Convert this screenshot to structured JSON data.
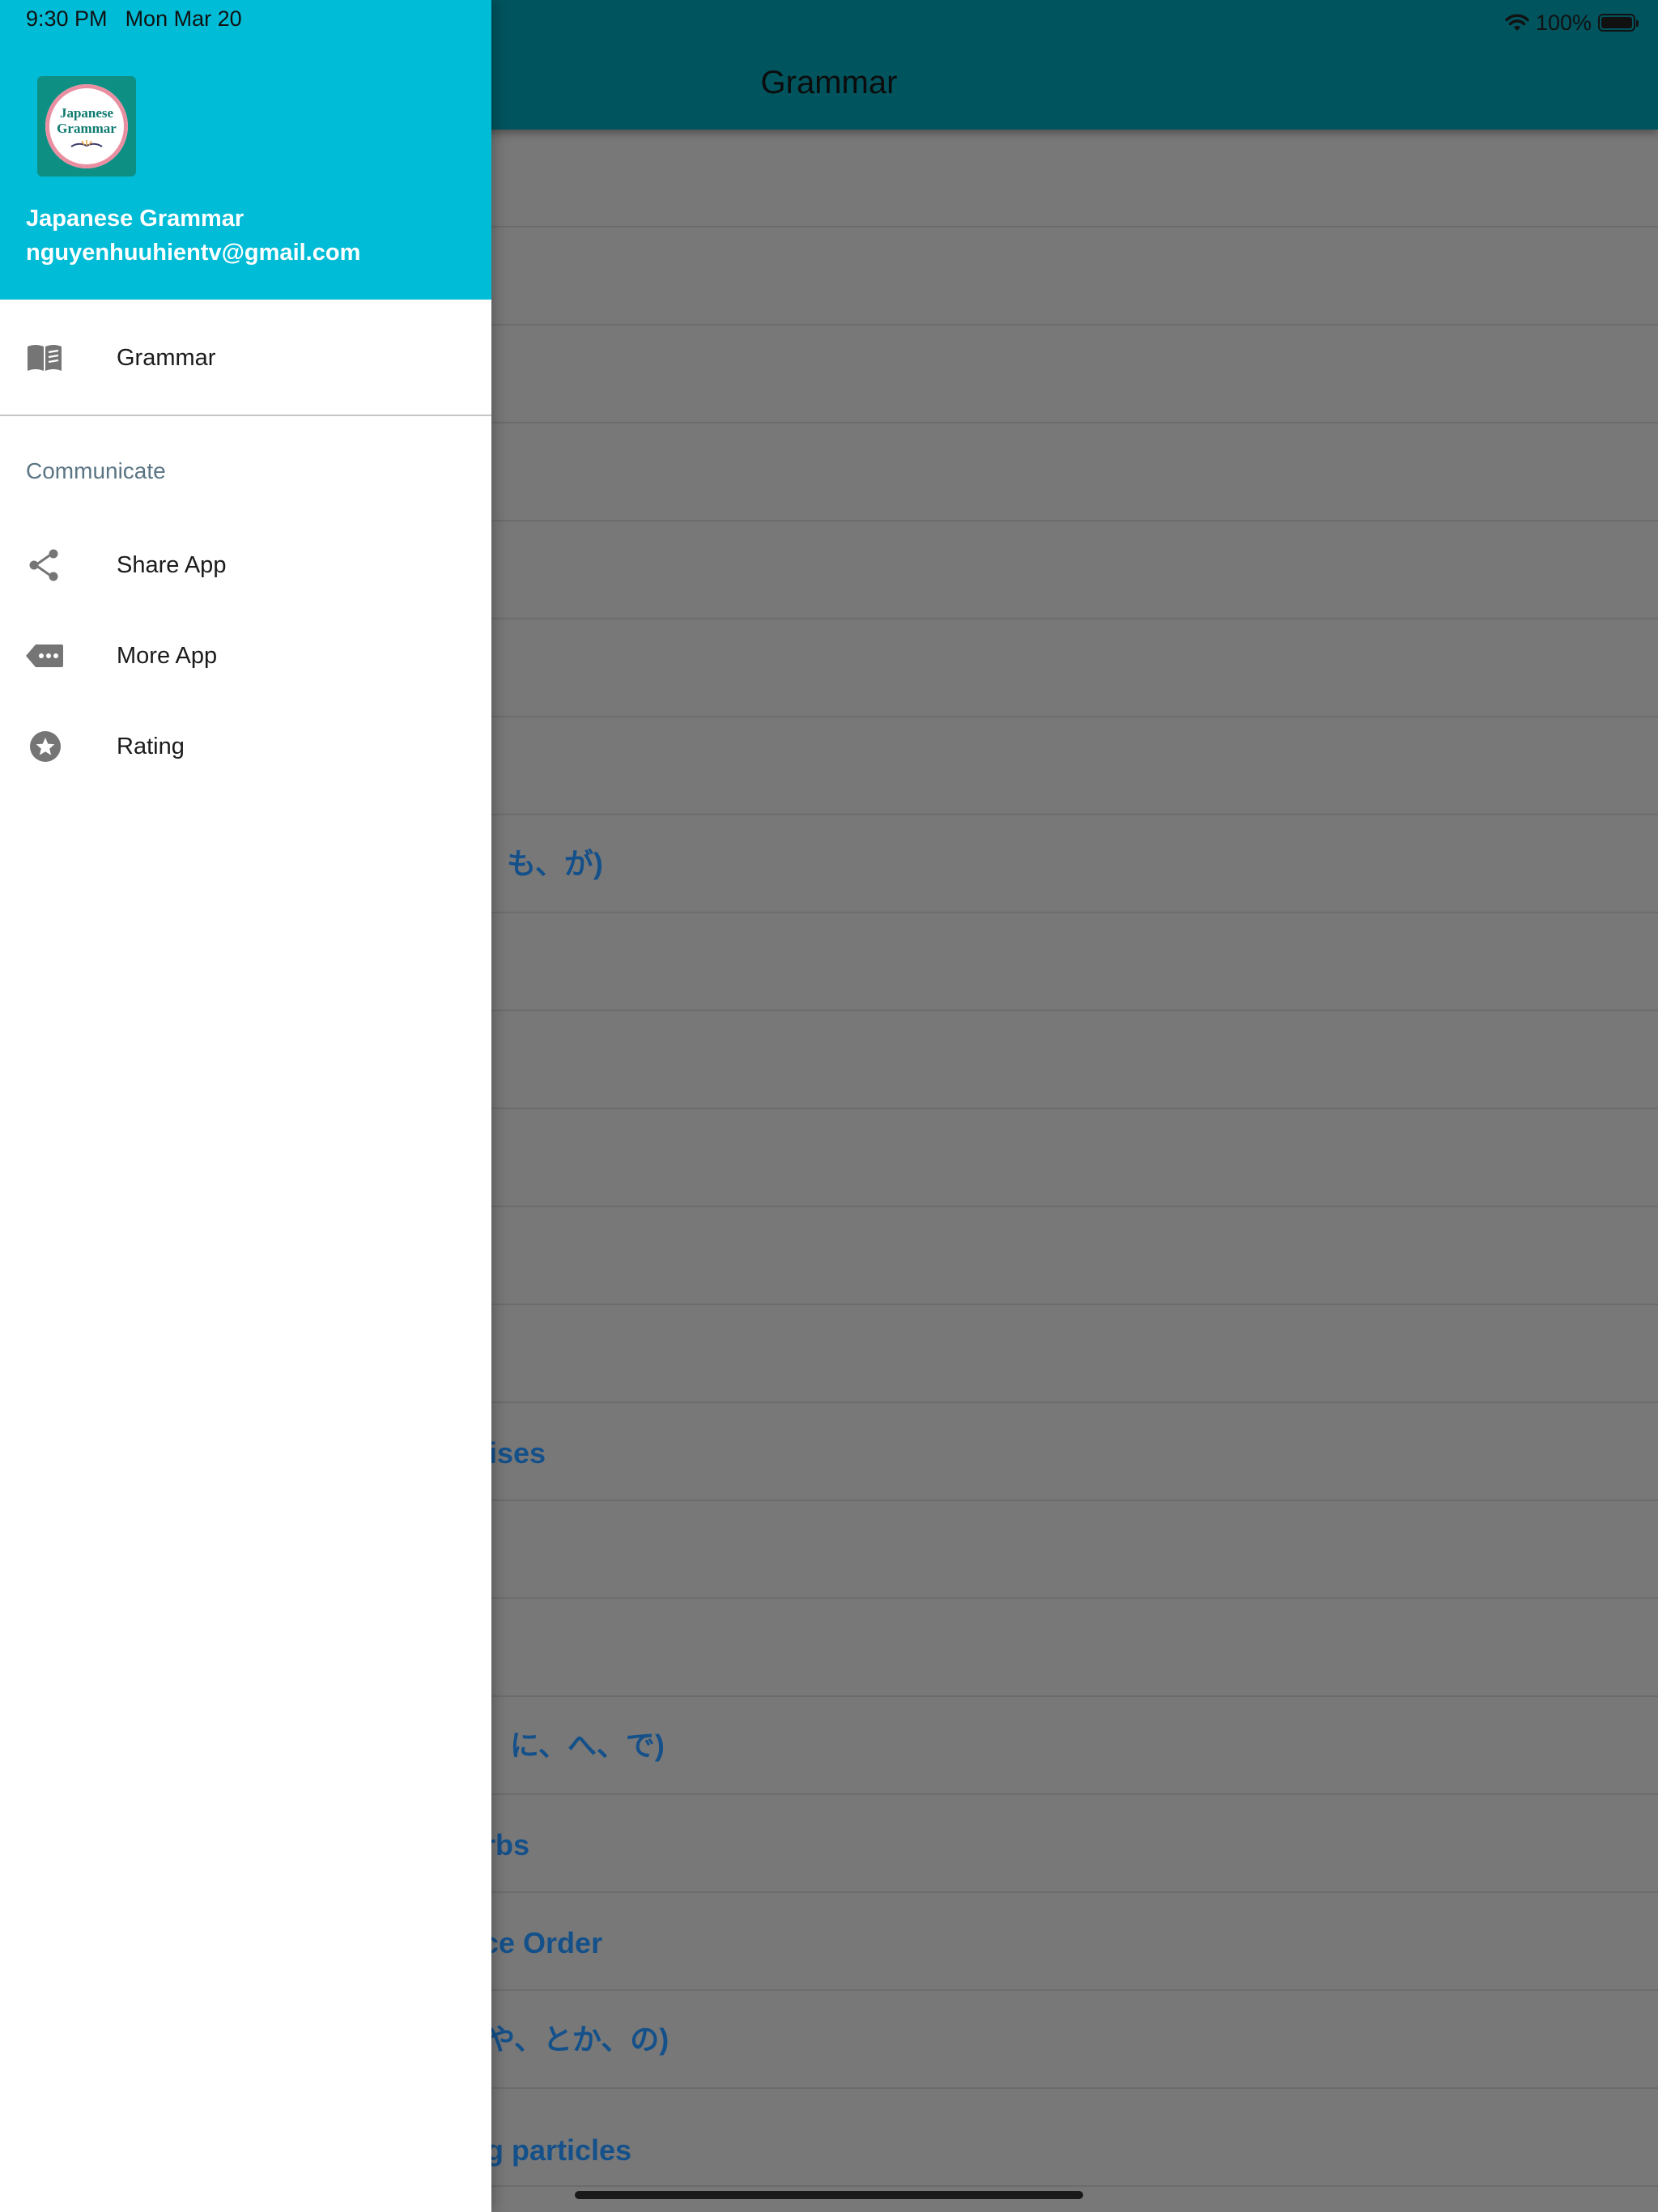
{
  "status_bar": {
    "time": "9:30 PM",
    "date": "Mon Mar 20",
    "battery": "100%"
  },
  "app_bar": {
    "title": "Grammar"
  },
  "background_list": {
    "rows": [
      {
        "text": ""
      },
      {
        "text": ""
      },
      {
        "text": ""
      },
      {
        "text": ""
      },
      {
        "text": ""
      },
      {
        "text": ""
      },
      {
        "text": ""
      },
      {
        "text": "も、が)"
      },
      {
        "text": ""
      },
      {
        "text": ""
      },
      {
        "text": ""
      },
      {
        "text": ""
      },
      {
        "text": ""
      },
      {
        "text": "ises"
      },
      {
        "text": ""
      },
      {
        "text": ""
      },
      {
        "text": "、に、へ、で)"
      },
      {
        "text": "rbs"
      },
      {
        "text": "ce Order"
      },
      {
        "text": "や、とか、の)"
      },
      {
        "text": "g particles"
      }
    ]
  },
  "drawer": {
    "header": {
      "logo_text": [
        "Japanese",
        "Grammar"
      ],
      "app_name": "Japanese Grammar",
      "email": "nguyenhuuhientv@gmail.com"
    },
    "primary_items": [
      {
        "label": "Grammar",
        "icon": "book-icon"
      }
    ],
    "section_label": "Communicate",
    "communicate_items": [
      {
        "label": "Share App",
        "icon": "share-icon"
      },
      {
        "label": "More App",
        "icon": "more-tag-icon"
      },
      {
        "label": "Rating",
        "icon": "star-icon"
      }
    ]
  },
  "colors": {
    "drawer_header": "#00bcd6",
    "app_bar": "#00545e",
    "scrim": "#787878",
    "list_text": "#14508a",
    "icon_gray": "#757575"
  }
}
